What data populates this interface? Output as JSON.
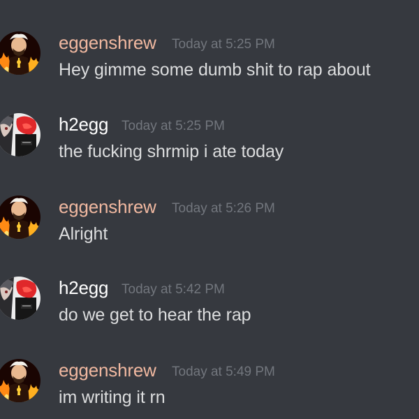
{
  "colors": {
    "background": "#36393f",
    "username_eggenshrew": "#f0b8a0",
    "username_h2egg": "#ffffff",
    "timestamp": "#72767d",
    "message_text": "#dcddde"
  },
  "messages": [
    {
      "username": "eggenshrew",
      "timestamp": "Today at 5:25 PM",
      "text": "Hey gimme some dumb shit to rap about",
      "avatar": "eggenshrew-avatar"
    },
    {
      "username": "h2egg",
      "timestamp": "Today at 5:25 PM",
      "text": "the fucking shrmip i ate today",
      "avatar": "h2egg-avatar"
    },
    {
      "username": "eggenshrew",
      "timestamp": "Today at 5:26 PM",
      "text": "Alright",
      "avatar": "eggenshrew-avatar"
    },
    {
      "username": "h2egg",
      "timestamp": "Today at 5:42 PM",
      "text": "do we get to hear the rap",
      "avatar": "h2egg-avatar"
    },
    {
      "username": "eggenshrew",
      "timestamp": "Today at 5:49 PM",
      "text": "im writing it rn",
      "avatar": "eggenshrew-avatar"
    }
  ]
}
